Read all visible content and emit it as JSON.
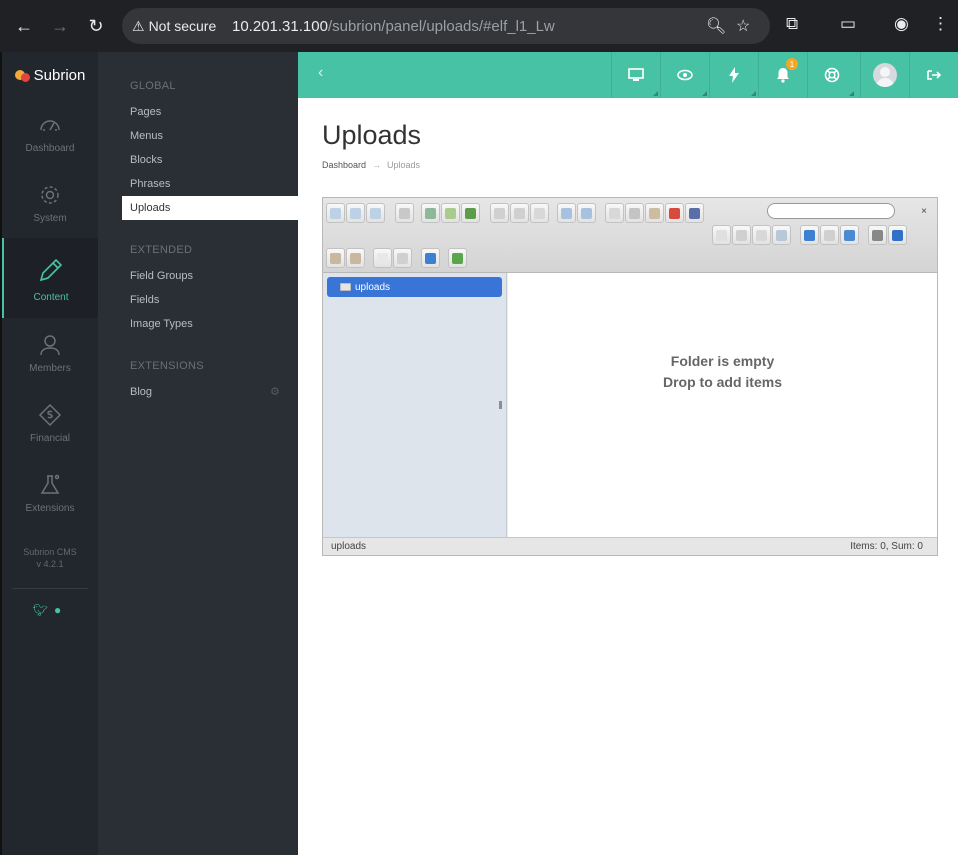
{
  "browser": {
    "security_label": "Not secure",
    "url_host": "10.201.31.100",
    "url_path": "/subrion/panel/uploads/#elf_l1_Lw"
  },
  "brand": {
    "name": "Subrion"
  },
  "icon_sidebar": {
    "items": [
      {
        "label": "Dashboard",
        "icon": "dashboard-gauge-icon"
      },
      {
        "label": "System",
        "icon": "gear-icon"
      },
      {
        "label": "Content",
        "icon": "pencil-icon"
      },
      {
        "label": "Members",
        "icon": "user-icon"
      },
      {
        "label": "Financial",
        "icon": "money-tag-icon"
      },
      {
        "label": "Extensions",
        "icon": "flask-icon"
      }
    ],
    "version_line1": "Subrion CMS",
    "version_line2": "v 4.2.1"
  },
  "sub_menu": {
    "global_title": "GLOBAL",
    "global_items": [
      "Pages",
      "Menus",
      "Blocks",
      "Phrases",
      "Uploads"
    ],
    "extended_title": "EXTENDED",
    "extended_items": [
      "Field Groups",
      "Fields",
      "Image Types"
    ],
    "extensions_title": "EXTENSIONS",
    "extensions_items": [
      "Blog"
    ]
  },
  "topbar": {
    "notification_count": "1"
  },
  "page": {
    "title": "Uploads",
    "breadcrumb_home": "Dashboard",
    "breadcrumb_arrow": "→",
    "breadcrumb_current": "Uploads"
  },
  "file_manager": {
    "close_glyph": "×",
    "root_folder": "uploads",
    "empty_line1": "Folder is empty",
    "empty_line2": "Drop to add items",
    "status_path": "uploads",
    "status_summary": "Items: 0, Sum: 0"
  },
  "colors": {
    "accent": "#48c2a4",
    "sidebar": "#22262d",
    "submenu": "#2a2e35",
    "selection": "#3875d7"
  }
}
